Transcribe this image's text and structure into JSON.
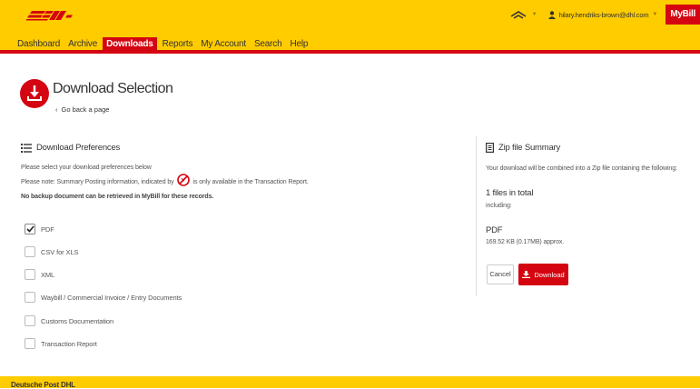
{
  "brand": {
    "logo_text": "DHL",
    "colors": {
      "yellow": "#ffcc00",
      "red": "#d40511"
    }
  },
  "topbar": {
    "user_email": "hilary.hendriks-brown@dhl.com",
    "app_button": "MyBill",
    "icons": [
      "dhl-wave-icon",
      "user-icon"
    ]
  },
  "nav": {
    "items": [
      {
        "label": "Dashboard"
      },
      {
        "label": "Archive"
      },
      {
        "label": "Downloads",
        "active": true
      },
      {
        "label": "Reports"
      },
      {
        "label": "My Account"
      },
      {
        "label": "Search"
      },
      {
        "label": "Help"
      }
    ]
  },
  "header": {
    "title": "Download Selection",
    "back_link": "Go back a page",
    "icon": "download-icon"
  },
  "preferences": {
    "title": "Download Preferences",
    "intro": "Please select your download preferences below",
    "note_before": "Please note: Summary Posting information, indicated by",
    "note_after": "is only available in the Transaction Report.",
    "warning": "No backup document can be retrieved in MyBill for these records.",
    "options": [
      {
        "label": "PDF",
        "checked": true
      },
      {
        "label": "CSV for XLS",
        "checked": false
      },
      {
        "label": "XML",
        "checked": false
      },
      {
        "label": "Waybill / Commercial Invoice / Entry Documents",
        "checked": false
      },
      {
        "label": "Customs Documentation",
        "checked": false
      },
      {
        "label": "Transaction Report",
        "checked": false
      }
    ]
  },
  "summary": {
    "title": "Zip file Summary",
    "description": "Your download will be combined into a Zip file containing the following:",
    "files_total": "1 files in total",
    "including": "including:",
    "file_type": "PDF",
    "file_size": "169.52 KB (0.17MB) approx.",
    "cancel_label": "Cancel",
    "download_label": "Download"
  },
  "footer": {
    "text": "Deutsche Post DHL"
  }
}
